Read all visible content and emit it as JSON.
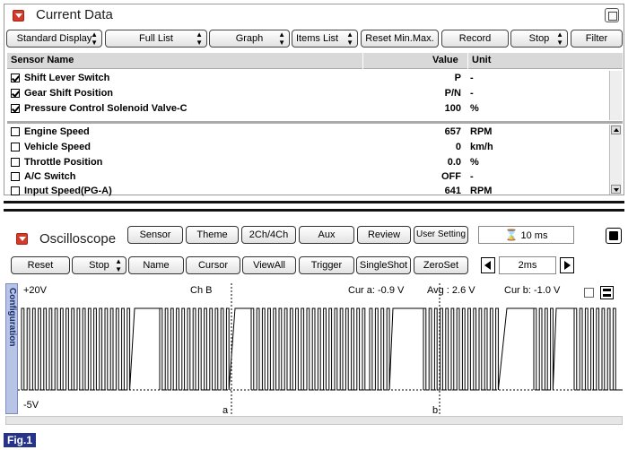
{
  "current_data": {
    "title": "Current Data",
    "toolbar": {
      "standard_display": "Standard Display",
      "full_list": "Full List",
      "graph": "Graph",
      "items_list": "Items List",
      "reset_min_max": "Reset Min.Max.",
      "record": "Record",
      "stop": "Stop",
      "filter": "Filter"
    },
    "columns": {
      "name": "Sensor Name",
      "value": "Value",
      "unit": "Unit"
    },
    "selected_rows": [
      {
        "checked": true,
        "name": "Shift Lever Switch",
        "value": "P",
        "unit": "-"
      },
      {
        "checked": true,
        "name": "Gear Shift Position",
        "value": "P/N",
        "unit": "-"
      },
      {
        "checked": true,
        "name": "Pressure Control Solenoid Valve-C",
        "value": "100",
        "unit": "%"
      }
    ],
    "rows": [
      {
        "checked": false,
        "name": "Engine Speed",
        "value": "657",
        "unit": "RPM"
      },
      {
        "checked": false,
        "name": "Vehicle Speed",
        "value": "0",
        "unit": "km/h"
      },
      {
        "checked": false,
        "name": "Throttle Position",
        "value": "0.0",
        "unit": "%"
      },
      {
        "checked": false,
        "name": "A/C Switch",
        "value": "OFF",
        "unit": "-"
      },
      {
        "checked": false,
        "name": "Input Speed(PG-A)",
        "value": "641",
        "unit": "RPM"
      }
    ]
  },
  "oscilloscope": {
    "title": "Oscilloscope",
    "top_buttons": {
      "sensor": "Sensor",
      "theme": "Theme",
      "channels": "2Ch/4Ch",
      "aux": "Aux",
      "review": "Review",
      "user_setting": "User Setting"
    },
    "time_display": "10 ms",
    "time_icon": "hourglass-icon",
    "bottom_buttons": {
      "reset": "Reset",
      "stop": "Stop",
      "name": "Name",
      "cursor": "Cursor",
      "view_all": "ViewAll",
      "trigger": "Trigger",
      "single_shot": "SingleShot",
      "zero_set": "ZeroSet"
    },
    "time_div": "2ms",
    "side_tab": "Configuration",
    "scope": {
      "v_max": "+20V",
      "v_min": "-5V",
      "channel": "Ch B",
      "cur_a": "Cur a: -0.9 V",
      "avg": "Avg : 2.6 V",
      "cur_b": "Cur b: -1.0 V",
      "cursor_a_label": "a",
      "cursor_b_label": "b",
      "trace_color": "#000000"
    }
  },
  "figure_label": "Fig.1"
}
